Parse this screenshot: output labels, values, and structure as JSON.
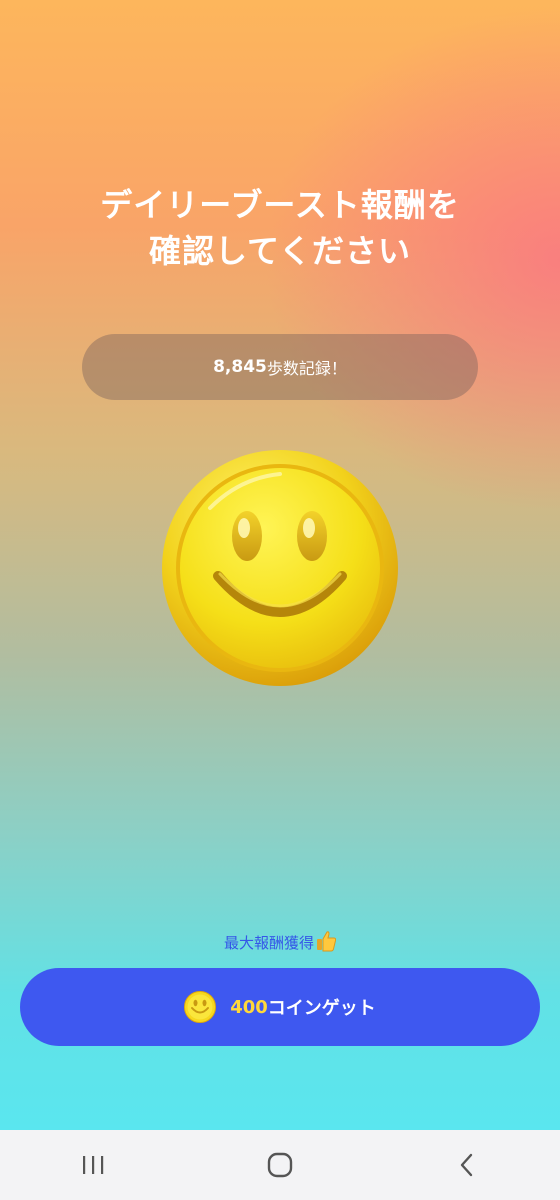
{
  "title": {
    "line1": "デイリーブースト報酬を",
    "line2": "確認してください"
  },
  "steps": {
    "count": "8,845",
    "suffix": "歩数記録！"
  },
  "reward": {
    "label": "最大報酬獲得",
    "label_icon": "thumbs-up-icon",
    "button_amount": "400",
    "button_text": "コインゲット",
    "button_icon": "smiley-coin-icon"
  },
  "navbar": {
    "items": [
      "recent-apps-icon",
      "home-icon",
      "back-icon"
    ]
  },
  "colors": {
    "button": "#3e58f0",
    "amount": "#ffd83a",
    "reward_label": "#3557e8"
  }
}
